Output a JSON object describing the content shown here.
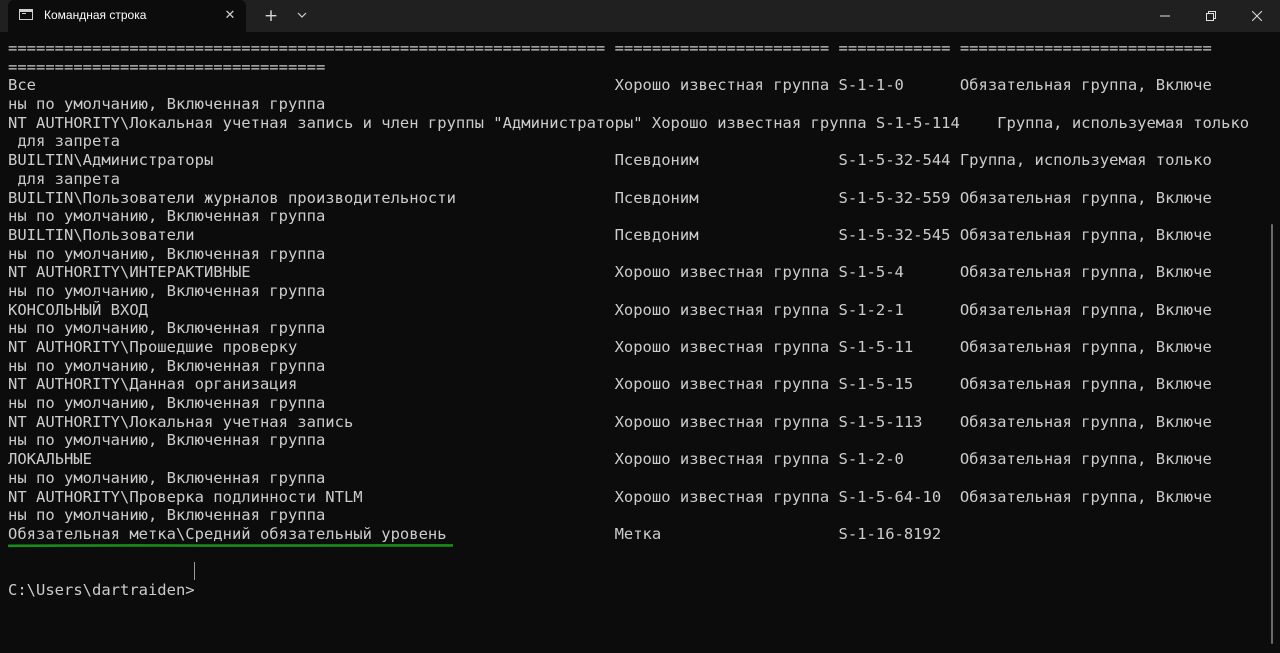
{
  "window": {
    "tab_title": "Командная строка",
    "tab_close_symbol": "✕",
    "new_tab_symbol": "+",
    "controls": [
      "minimize-icon",
      "maximize-icon",
      "close-icon"
    ]
  },
  "console": {
    "lines": [
      "================================================================ ======================= ============ ===========================",
      "==================================",
      "Все                                                              Хорошо известная группа S-1-1-0      Обязательная группа, Включе",
      "ны по умолчанию, Включенная группа",
      "NT AUTHORITY\\Локальная учетная запись и член группы \"Администраторы\" Хорошо известная группа S-1-5-114    Группа, используемая только",
      " для запрета",
      "BUILTIN\\Администраторы                                           Псевдоним               S-1-5-32-544 Группа, используемая только",
      " для запрета",
      "BUILTIN\\Пользователи журналов производительности                 Псевдоним               S-1-5-32-559 Обязательная группа, Включе",
      "ны по умолчанию, Включенная группа",
      "BUILTIN\\Пользователи                                             Псевдоним               S-1-5-32-545 Обязательная группа, Включе",
      "ны по умолчанию, Включенная группа",
      "NT AUTHORITY\\ИНТЕРАКТИВНЫЕ                                       Хорошо известная группа S-1-5-4      Обязательная группа, Включе",
      "ны по умолчанию, Включенная группа",
      "КОНСОЛЬНЫЙ ВХОД                                                  Хорошо известная группа S-1-2-1      Обязательная группа, Включе",
      "ны по умолчанию, Включенная группа",
      "NT AUTHORITY\\Прошедшие проверку                                  Хорошо известная группа S-1-5-11     Обязательная группа, Включе",
      "ны по умолчанию, Включенная группа",
      "NT AUTHORITY\\Данная организация                                  Хорошо известная группа S-1-5-15     Обязательная группа, Включе",
      "ны по умолчанию, Включенная группа",
      "NT AUTHORITY\\Локальная учетная запись                            Хорошо известная группа S-1-5-113    Обязательная группа, Включе",
      "ны по умолчанию, Включенная группа",
      "ЛОКАЛЬНЫЕ                                                        Хорошо известная группа S-1-2-0      Обязательная группа, Включе",
      "ны по умолчанию, Включенная группа",
      "NT AUTHORITY\\Проверка подлинности NTLM                           Хорошо известная группа S-1-5-64-10  Обязательная группа, Включе",
      "ны по умолчанию, Включенная группа",
      "Обязательная метка\\Средний обязательный уровень                  Метка                   S-1-16-8192",
      "",
      "",
      "C:\\Users\\dartraiden>"
    ]
  },
  "colors": {
    "background": "#0c0c0c",
    "titlebar": "#202020",
    "text": "#cccccc",
    "highlight_underline": "#1a8a1a"
  }
}
